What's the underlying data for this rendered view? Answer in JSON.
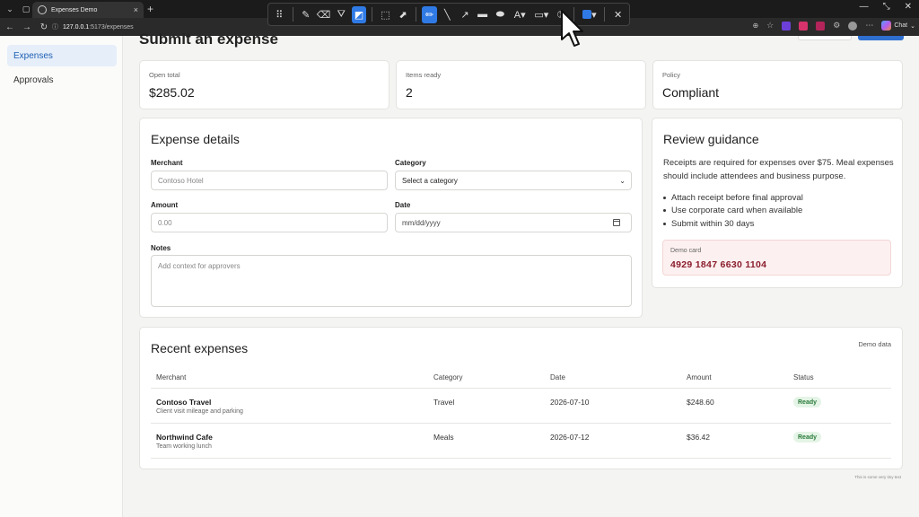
{
  "browser": {
    "tab_title": "Expenses Demo",
    "url_host": "127.0.0.1",
    "url_rest": ":5173/expenses",
    "chat_label": "Chat"
  },
  "sidebar": {
    "items": [
      {
        "label": "Expenses",
        "active": true
      },
      {
        "label": "Approvals",
        "active": false
      }
    ]
  },
  "page": {
    "title": "Submit an expense"
  },
  "stats": [
    {
      "label": "Open total",
      "value": "$285.02"
    },
    {
      "label": "Items ready",
      "value": "2"
    },
    {
      "label": "Policy",
      "value": "Compliant"
    }
  ],
  "form": {
    "title": "Expense details",
    "merchant_label": "Merchant",
    "merchant_placeholder": "Contoso Hotel",
    "category_label": "Category",
    "category_value": "Select a category",
    "amount_label": "Amount",
    "amount_placeholder": "0.00",
    "date_label": "Date",
    "date_placeholder": "mm/dd/yyyy",
    "notes_label": "Notes",
    "notes_placeholder": "Add context for approvers"
  },
  "guidance": {
    "title": "Review guidance",
    "text": "Receipts are required for expenses over $75. Meal expenses should include attendees and business purpose.",
    "items": [
      "Attach receipt before final approval",
      "Use corporate card when available",
      "Submit within 30 days"
    ],
    "demo_card_label": "Demo card",
    "demo_card_number": "4929 1847 6630 1104"
  },
  "recent": {
    "title": "Recent expenses",
    "tag": "Demo data",
    "columns": [
      "Merchant",
      "Category",
      "Date",
      "Amount",
      "Status"
    ],
    "rows": [
      {
        "merchant": "Contoso Travel",
        "note": "Client visit mileage and parking",
        "category": "Travel",
        "date": "2026-07-10",
        "amount": "$248.60",
        "status": "Ready"
      },
      {
        "merchant": "Northwind Cafe",
        "note": "Team working lunch",
        "category": "Meals",
        "date": "2026-07-12",
        "amount": "$36.42",
        "status": "Ready"
      }
    ]
  },
  "footer_note": "This is some very tiny text",
  "colors": {
    "accent": "#2f7ae5",
    "sidebar_active_bg": "#e6eef9",
    "demo_card_text": "#8b1d2c",
    "badge_bg": "#e4f4e6"
  }
}
